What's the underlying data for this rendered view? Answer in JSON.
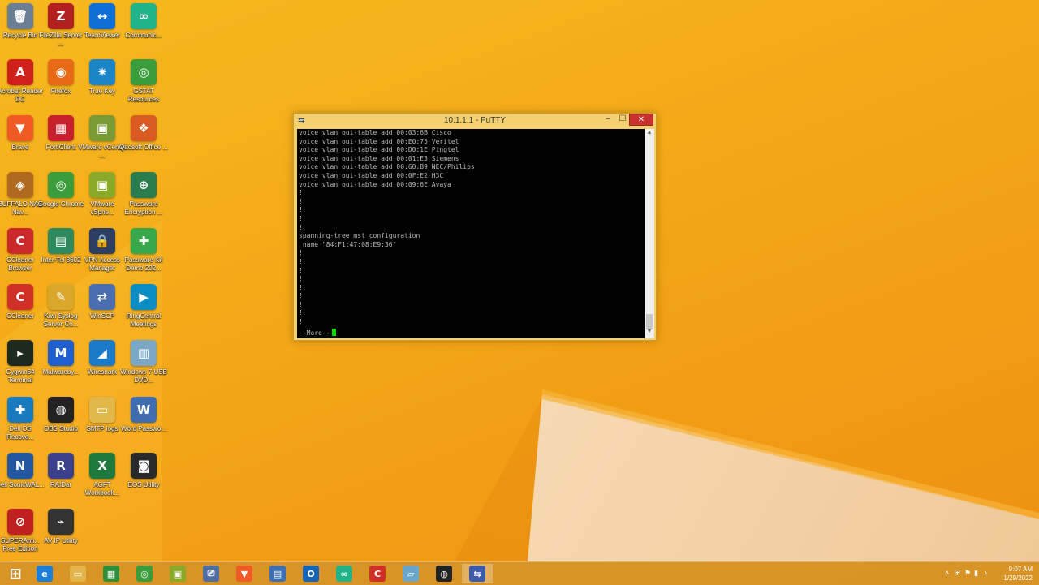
{
  "desktop_icons": [
    {
      "label": "Recycle Bin",
      "icon": "recycle-bin-icon",
      "glyph": "🗑",
      "color": "#6a7f94"
    },
    {
      "label": "FileZilla Server ...",
      "icon": "filezilla-icon",
      "glyph": "Z",
      "color": "#b32020"
    },
    {
      "label": "TeamViewer",
      "icon": "teamviewer-icon",
      "glyph": "↔",
      "color": "#0e6fd6"
    },
    {
      "label": "Communic...",
      "icon": "communicator-icon",
      "glyph": "∞",
      "color": "#21b38a"
    },
    {
      "label": "Acrobat Reader DC",
      "icon": "acrobat-icon",
      "glyph": "A",
      "color": "#d0201a"
    },
    {
      "label": "Firefox",
      "icon": "firefox-icon",
      "glyph": "◉",
      "color": "#e86a17"
    },
    {
      "label": "True Key",
      "icon": "truekey-icon",
      "glyph": "✷",
      "color": "#1a86c7"
    },
    {
      "label": "GSTAT Resources",
      "icon": "chrome-icon",
      "glyph": "◎",
      "color": "#3a9c3a"
    },
    {
      "label": "Brave",
      "icon": "brave-icon",
      "glyph": "▼",
      "color": "#f05a24"
    },
    {
      "label": "FortiClient",
      "icon": "forticlient-icon",
      "glyph": "▦",
      "color": "#c8202c"
    },
    {
      "label": "VMware vCenter ...",
      "icon": "vmware-icon",
      "glyph": "▣",
      "color": "#7a9a36"
    },
    {
      "label": "Qaosoft Office ...",
      "icon": "office-icon",
      "glyph": "❖",
      "color": "#d95b22"
    },
    {
      "label": "BUFFALO NAS Nav...",
      "icon": "buffalo-icon",
      "glyph": "◈",
      "color": "#b06a20"
    },
    {
      "label": "Google Chrome",
      "icon": "chrome-icon",
      "glyph": "◎",
      "color": "#3a9c3a"
    },
    {
      "label": "VMware vSphe...",
      "icon": "vsphere-icon",
      "glyph": "▣",
      "color": "#8caa2a"
    },
    {
      "label": "Passware Encryption ...",
      "icon": "passware-icon",
      "glyph": "⊕",
      "color": "#2b7d4e"
    },
    {
      "label": "CCleaner Browser",
      "icon": "ccleaner-browser-icon",
      "glyph": "C",
      "color": "#cc2a2a"
    },
    {
      "label": "Inter-Tel 8602",
      "icon": "intertel-icon",
      "glyph": "▤",
      "color": "#2e8a5e"
    },
    {
      "label": "VPN Access Manager",
      "icon": "vpn-lock-icon",
      "glyph": "🔒",
      "color": "#2d3e63"
    },
    {
      "label": "Passware Kit Demo 202...",
      "icon": "passware-kit-icon",
      "glyph": "✚",
      "color": "#38a84a"
    },
    {
      "label": "CCleaner",
      "icon": "ccleaner-icon",
      "glyph": "C",
      "color": "#d03028"
    },
    {
      "label": "Kiwi Syslog Server Co...",
      "icon": "kiwi-syslog-icon",
      "glyph": "✎",
      "color": "#d9a82a"
    },
    {
      "label": "WinSCP",
      "icon": "winscp-icon",
      "glyph": "⇄",
      "color": "#4a6fb0"
    },
    {
      "label": "RingCentral Meetings",
      "icon": "ringcentral-icon",
      "glyph": "▶",
      "color": "#0a8dc2"
    },
    {
      "label": "Cygwin64 Terminal",
      "icon": "cygwin-terminal-icon",
      "glyph": "▸",
      "color": "#1e2a1e"
    },
    {
      "label": "Malwareby...",
      "icon": "malwarebytes-icon",
      "glyph": "M",
      "color": "#1f5fd0"
    },
    {
      "label": "Wireshark",
      "icon": "wireshark-icon",
      "glyph": "◢",
      "color": "#1b79c9"
    },
    {
      "label": "Windows 7 USB DVD...",
      "icon": "usb-dvd-icon",
      "glyph": "▥",
      "color": "#7ba8c7"
    },
    {
      "label": "Dell OS Recove...",
      "icon": "dell-recovery-icon",
      "glyph": "✚",
      "color": "#1a7ac0"
    },
    {
      "label": "OBS Studio",
      "icon": "obs-icon",
      "glyph": "◍",
      "color": "#222222"
    },
    {
      "label": "SMTP logs",
      "icon": "folder-icon",
      "glyph": "▭",
      "color": "#e3b84a"
    },
    {
      "label": "Word Passwo...",
      "icon": "word-password-icon",
      "glyph": "W",
      "color": "#3f6db0"
    },
    {
      "label": "Dell SonicWAL...",
      "icon": "sonicwall-icon",
      "glyph": "N",
      "color": "#2357a0"
    },
    {
      "label": "RAIDar",
      "icon": "raidar-icon",
      "glyph": "R",
      "color": "#3b3f8c"
    },
    {
      "label": "AGFT Workbook...",
      "icon": "excel-icon",
      "glyph": "X",
      "color": "#1d7a3c"
    },
    {
      "label": "EOS Utility",
      "icon": "camera-icon",
      "glyph": "◙",
      "color": "#2a2a2a"
    },
    {
      "label": "SUPERAnti... Free Edition",
      "icon": "superantispyware-icon",
      "glyph": "⊘",
      "color": "#c02020"
    },
    {
      "label": "AV IP Utility",
      "icon": "av-ip-utility-icon",
      "glyph": "⌁",
      "color": "#333333"
    }
  ],
  "putty": {
    "title": "10.1.1.1 - PuTTY",
    "min_glyph": "–",
    "max_glyph": "☐",
    "close_glyph": "✕",
    "terminal_lines": [
      "voice vlan oui-table add 00:03:6B Cisco",
      "voice vlan oui-table add 00:E0:75 Veritel",
      "voice vlan oui-table add 00:D0:1E Pingtel",
      "voice vlan oui-table add 00:01:E3 Siemens",
      "voice vlan oui-table add 00:60:B9 NEC/Philips",
      "voice vlan oui-table add 00:0F:E2 H3C",
      "voice vlan oui-table add 00:09:6E Avaya",
      "!",
      "!",
      "!",
      "!",
      "!",
      "spanning-tree mst configuration",
      " name \"84:F1:47:08:E9:36\"",
      "!",
      "!",
      "!",
      "!",
      "!",
      "!",
      "!",
      "!",
      "!"
    ],
    "prompt": "--More--"
  },
  "taskbar": {
    "items": [
      {
        "name": "ie-icon",
        "glyph": "e",
        "color": "#1a7fd8"
      },
      {
        "name": "file-explorer-icon",
        "glyph": "▭",
        "color": "#e2b449"
      },
      {
        "name": "store-icon",
        "glyph": "▦",
        "color": "#2e8f3a"
      },
      {
        "name": "chrome-icon",
        "glyph": "◎",
        "color": "#3a9c3a"
      },
      {
        "name": "vmware-icon",
        "glyph": "▣",
        "color": "#8caa2a"
      },
      {
        "name": "network-icon",
        "glyph": "⎚",
        "color": "#4f6fa4"
      },
      {
        "name": "brave-icon",
        "glyph": "▼",
        "color": "#f05a24"
      },
      {
        "name": "remote-desktop-icon",
        "glyph": "▤",
        "color": "#3d6fb2"
      },
      {
        "name": "outlook-icon",
        "glyph": "O",
        "color": "#1664b8"
      },
      {
        "name": "communicator-icon",
        "glyph": "∞",
        "color": "#21b38a"
      },
      {
        "name": "ccleaner-icon",
        "glyph": "C",
        "color": "#d03028"
      },
      {
        "name": "notepad-icon",
        "glyph": "▱",
        "color": "#6aa6c9"
      },
      {
        "name": "obs-icon",
        "glyph": "◍",
        "color": "#222222"
      },
      {
        "name": "putty-icon",
        "glyph": "⇆",
        "color": "#3b5aa8"
      }
    ],
    "start_glyph": "⊞",
    "clock_time": "9:07 AM",
    "clock_date": "1/29/2022",
    "tray_glyphs": [
      "˄",
      "⛨",
      "⚑",
      "▮",
      "♪"
    ]
  }
}
